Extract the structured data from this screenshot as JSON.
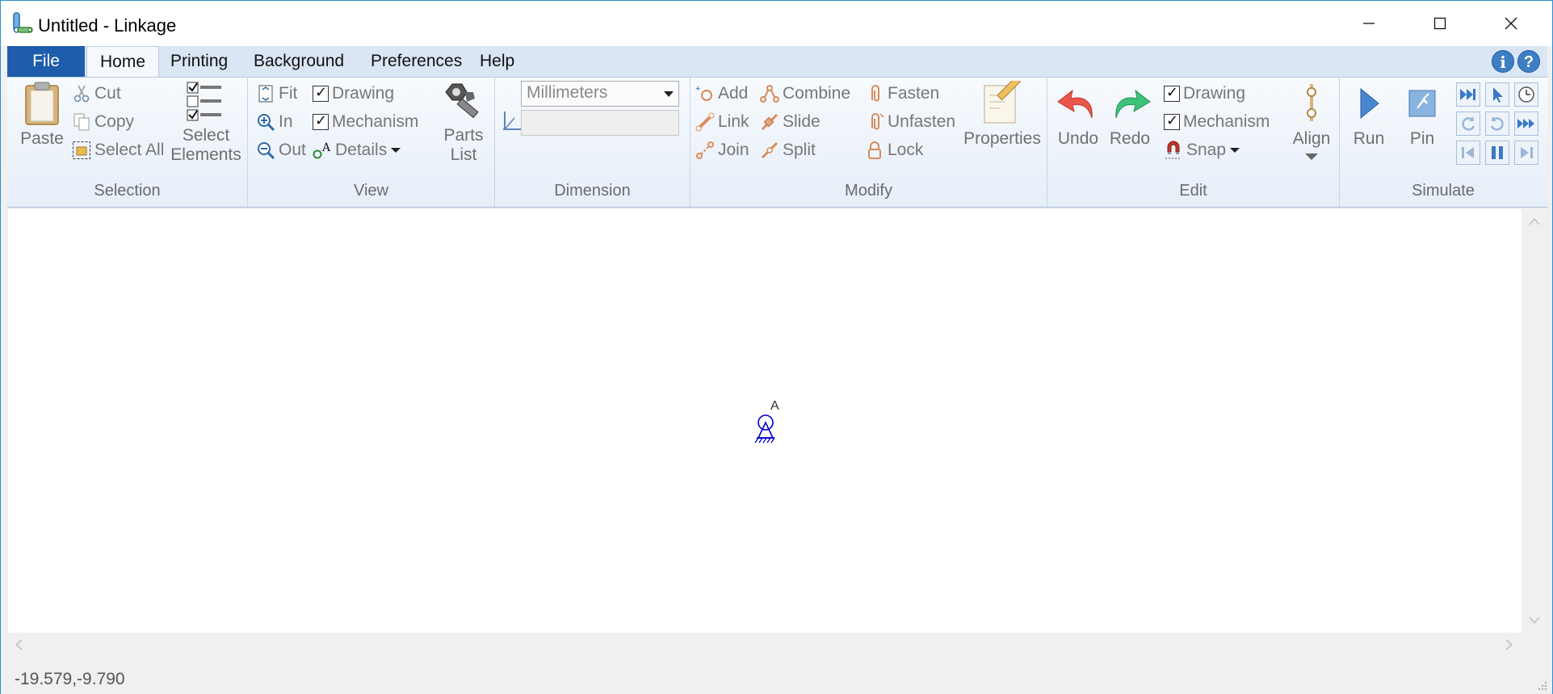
{
  "window": {
    "title": "Untitled - Linkage",
    "minimize_glyph": "—",
    "maximize_glyph": "☐",
    "close_glyph": "✕"
  },
  "menu": {
    "tabs": [
      "File",
      "Home",
      "Printing",
      "Background",
      "Preferences",
      "Help"
    ],
    "active_tab": "Home",
    "info_glyph": "i",
    "help_glyph": "?"
  },
  "ribbon": {
    "selection": {
      "label": "Selection",
      "paste": "Paste",
      "cut": "Cut",
      "copy": "Copy",
      "select_all": "Select All",
      "select_elements_line1": "Select",
      "select_elements_line2": "Elements"
    },
    "view": {
      "label": "View",
      "fit": "Fit",
      "zoom_in": "In",
      "zoom_out": "Out",
      "drawing": "Drawing",
      "mechanism": "Mechanism",
      "details": "Details",
      "parts_list_line1": "Parts",
      "parts_list_line2": "List"
    },
    "dimension": {
      "label": "Dimension",
      "units_selected": "Millimeters",
      "value": ""
    },
    "modify": {
      "label": "Modify",
      "add": "Add",
      "link": "Link",
      "join": "Join",
      "combine": "Combine",
      "slide": "Slide",
      "split": "Split",
      "fasten": "Fasten",
      "unfasten": "Unfasten",
      "lock": "Lock",
      "properties": "Properties"
    },
    "edit": {
      "label": "Edit",
      "undo": "Undo",
      "redo": "Redo",
      "drawing": "Drawing",
      "mechanism": "Mechanism",
      "snap": "Snap",
      "align": "Align"
    },
    "simulate": {
      "label": "Simulate",
      "run": "Run",
      "pin": "Pin"
    }
  },
  "canvas": {
    "joint_label": "A"
  },
  "status": {
    "coordinates": "-19.579,-9.790"
  },
  "colors": {
    "accent": "#1e5dab",
    "mechanism": "#0000cc",
    "undo": "#e84c3d",
    "redo": "#2fbf6a"
  }
}
